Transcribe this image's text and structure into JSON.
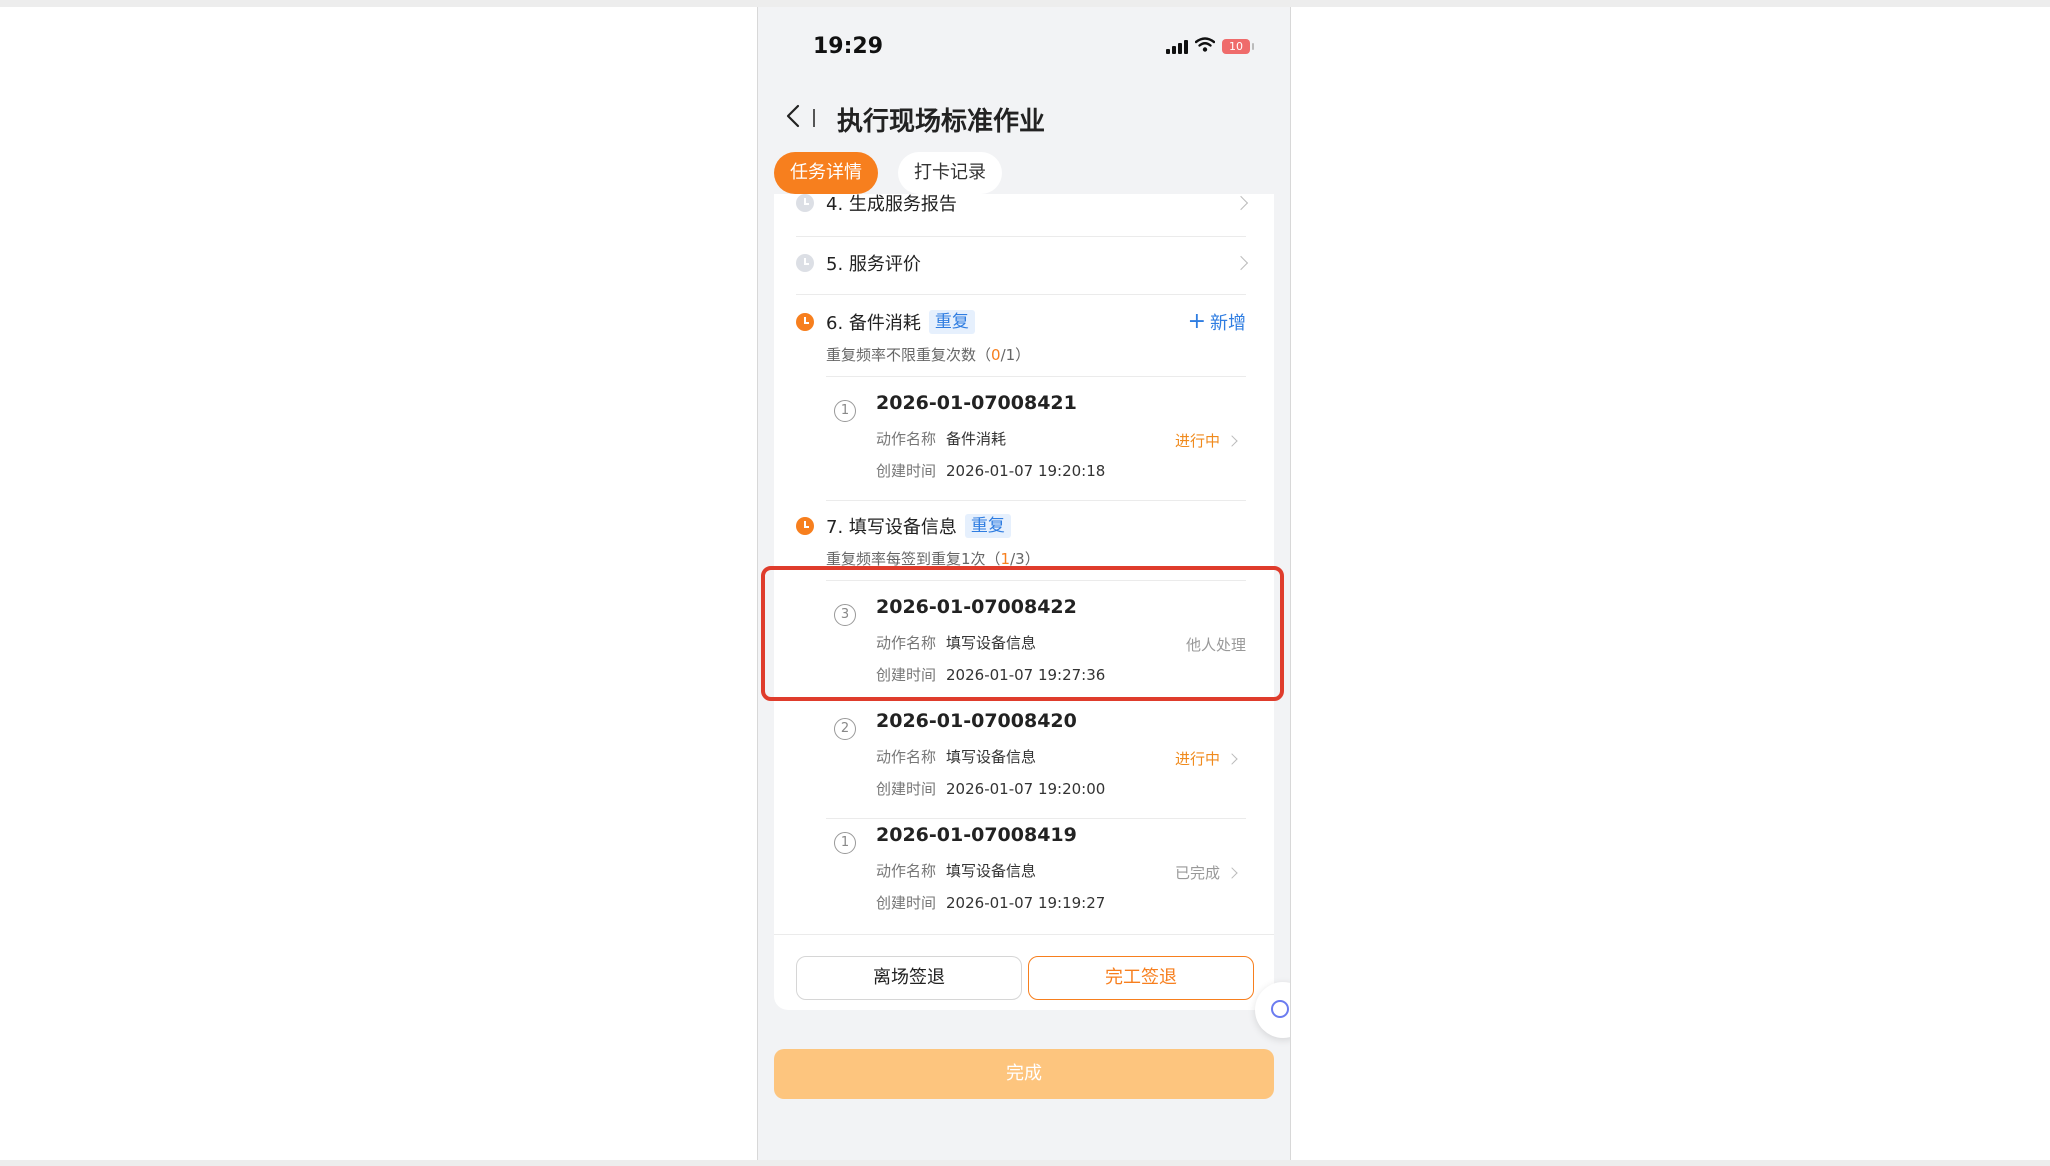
{
  "status_bar": {
    "time": "19:29",
    "battery": "10"
  },
  "nav": {
    "title": "执行现场标准作业"
  },
  "tabs": [
    {
      "label": "任务详情",
      "active": true
    },
    {
      "label": "打卡记录",
      "active": false
    }
  ],
  "steps": {
    "step4": {
      "label": "4. 生成服务报告"
    },
    "step5": {
      "label": "5. 服务评价"
    },
    "step6": {
      "label": "6. 备件消耗",
      "tag": "重复",
      "add_label": "新增",
      "freq_prefix": "重复频率不限重复次数（",
      "freq_done": "0",
      "freq_suffix": "/1）",
      "records": [
        {
          "num": "1",
          "id": "2026-01-07008421",
          "action_label": "动作名称",
          "action": "备件消耗",
          "time_label": "创建时间",
          "time": "2026-01-07 19:20:18",
          "status": "进行中"
        }
      ]
    },
    "step7": {
      "label": "7. 填写设备信息",
      "tag": "重复",
      "freq_prefix": "重复频率每签到重复1次（",
      "freq_done": "1",
      "freq_suffix": "/3）",
      "records": [
        {
          "num": "3",
          "id": "2026-01-07008422",
          "action_label": "动作名称",
          "action": "填写设备信息",
          "time_label": "创建时间",
          "time": "2026-01-07 19:27:36",
          "status": "他人处理"
        },
        {
          "num": "2",
          "id": "2026-01-07008420",
          "action_label": "动作名称",
          "action": "填写设备信息",
          "time_label": "创建时间",
          "time": "2026-01-07 19:20:00",
          "status": "进行中"
        },
        {
          "num": "1",
          "id": "2026-01-07008419",
          "action_label": "动作名称",
          "action": "填写设备信息",
          "time_label": "创建时间",
          "time": "2026-01-07 19:19:27",
          "status": "已完成"
        }
      ]
    }
  },
  "buttons": {
    "leave": "离场签退",
    "finish_checkout": "完工签退",
    "complete": "完成"
  },
  "colors": {
    "accent_orange": "#f77f1e",
    "tag_blue": "#2f7de1",
    "highlight_red": "#df3c2c",
    "complete_disabled": "#fdc57e"
  }
}
